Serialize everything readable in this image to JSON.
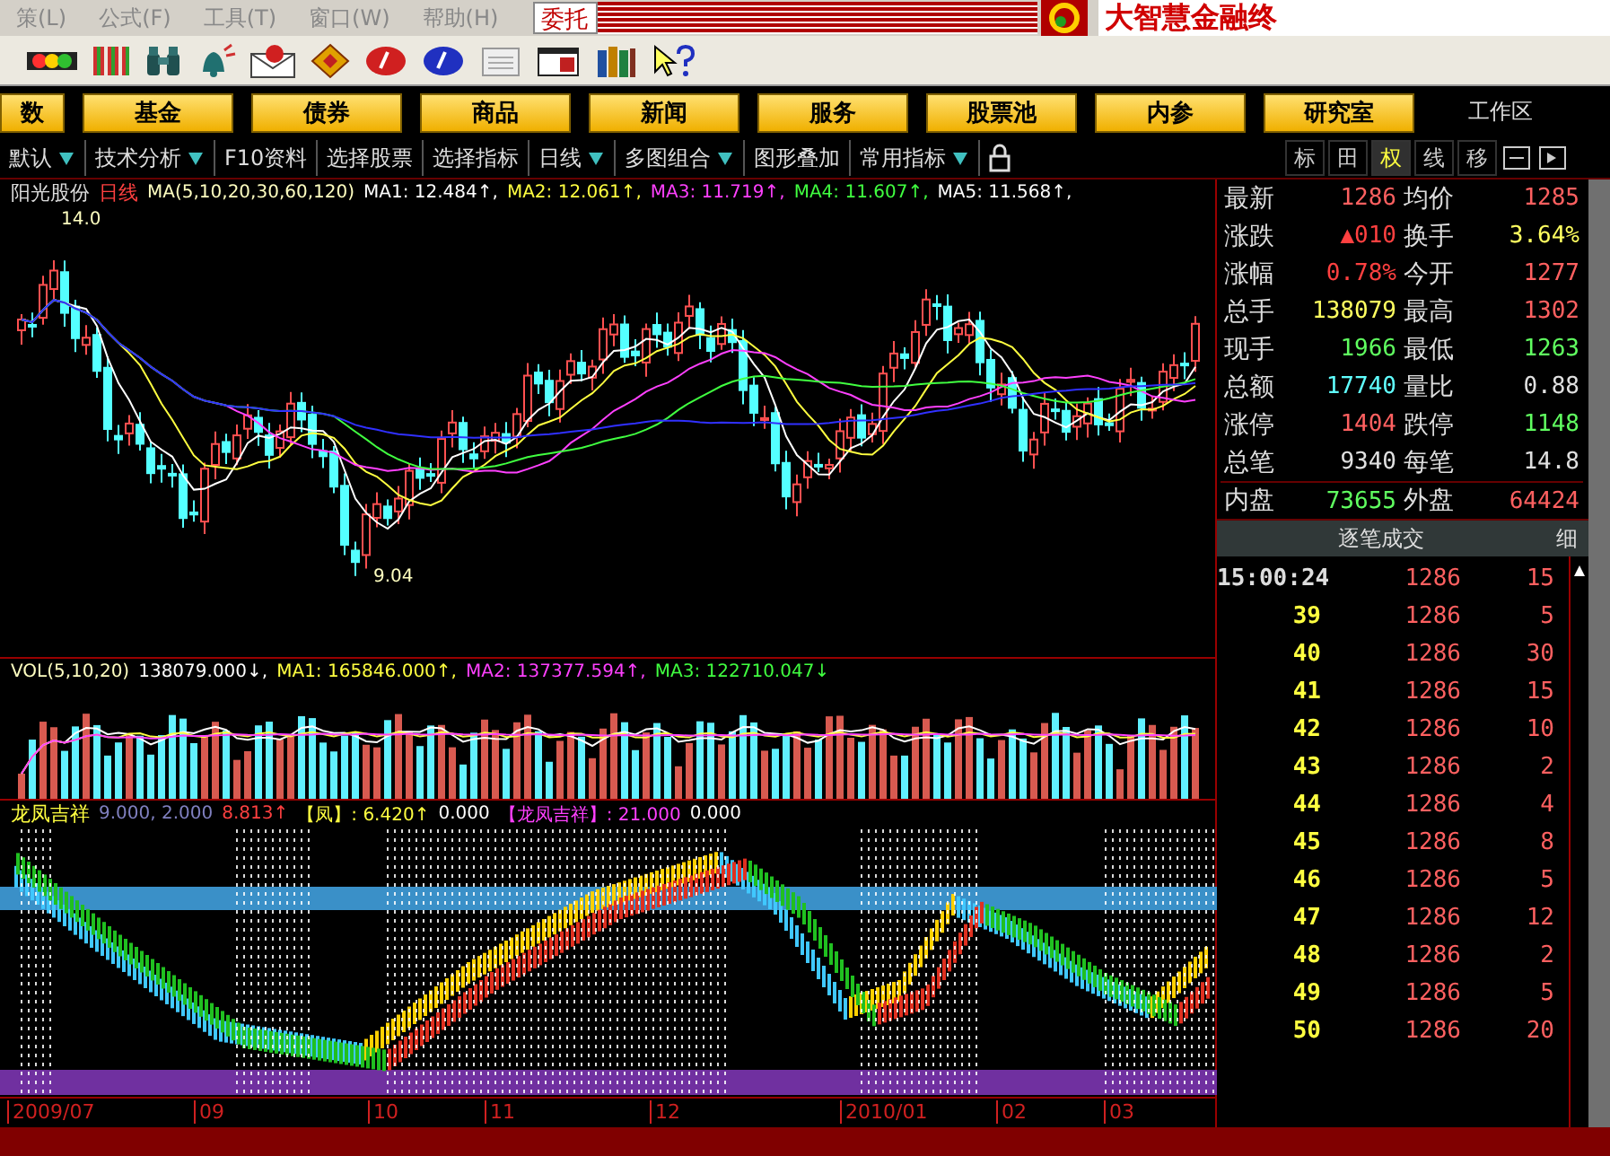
{
  "menu_bar": {
    "items": [
      "策(L)",
      "公式(F)",
      "工具(T)",
      "窗口(W)",
      "帮助(H)"
    ],
    "order_button": "委托",
    "brand": "大智慧金融终"
  },
  "market_buttons": [
    "数",
    "基金",
    "债券",
    "商品",
    "新闻",
    "服务",
    "股票池",
    "内参",
    "研究室"
  ],
  "workspace": "工作区",
  "view_tabs": [
    {
      "label": "默认",
      "dropdown": true
    },
    {
      "label": "技术分析",
      "dropdown": true
    },
    {
      "label": "F10资料",
      "dropdown": false
    },
    {
      "label": "选择股票",
      "dropdown": false
    },
    {
      "label": "选择指标",
      "dropdown": false
    },
    {
      "label": "日线",
      "dropdown": true
    },
    {
      "label": "多图组合",
      "dropdown": true
    },
    {
      "label": "图形叠加",
      "dropdown": false
    },
    {
      "label": "常用指标",
      "dropdown": true
    }
  ],
  "panel_tabs": [
    {
      "label": "标",
      "selected": false
    },
    {
      "label": "田",
      "selected": false
    },
    {
      "label": "权",
      "selected": true
    },
    {
      "label": "线",
      "selected": false
    },
    {
      "label": "移",
      "selected": false
    }
  ],
  "price_chart": {
    "stock": "阳光股份",
    "period": "日线",
    "params": "MA(5,10,20,30,60,120)",
    "values": [
      {
        "text": "MA1: 12.484↑,",
        "color": "#ffffff"
      },
      {
        "text": "MA2: 12.061↑,",
        "color": "#ffff40"
      },
      {
        "text": "MA3: 11.719↑,",
        "color": "#ff40ff"
      },
      {
        "text": "MA4: 11.607↑,",
        "color": "#40ff40"
      },
      {
        "text": "MA5: 11.568↑,",
        "color": "#ffffff"
      }
    ],
    "high_label": "14.0",
    "low_label": "9.04"
  },
  "volume_chart": {
    "title": "VOL(5,10,20)",
    "values": [
      {
        "text": "138079.000↓,",
        "color": "#ffffff"
      },
      {
        "text": "MA1: 165846.000↑,",
        "color": "#ffff40"
      },
      {
        "text": "MA2: 137377.594↑,",
        "color": "#ff40ff"
      },
      {
        "text": "MA3: 122710.047↓",
        "color": "#40ff40"
      }
    ]
  },
  "indicator": {
    "name": "龙凤吉祥",
    "values": [
      {
        "text": "9.000, 2.000",
        "color": "#8080c0"
      },
      {
        "text": "8.813↑",
        "color": "#ff4040"
      },
      {
        "text": "【凤】: 6.420↑",
        "color": "#ffff40"
      },
      {
        "text": "0.000",
        "color": "#ffffff"
      },
      {
        "text": "【龙凤吉祥】: 21.000",
        "color": "#ff40ff"
      },
      {
        "text": "0.000",
        "color": "#ffffff"
      }
    ]
  },
  "date_axis": [
    "2009/07",
    "09",
    "10",
    "11",
    "12",
    "2010/01",
    "02",
    "03"
  ],
  "quote": [
    {
      "label": "最新",
      "value": "1286",
      "color": "#ff6060"
    },
    {
      "label": "均价",
      "value": "1285",
      "color": "#ff6060"
    },
    {
      "label": "涨跌",
      "value": "▲010",
      "color": "#ff4040"
    },
    {
      "label": "换手",
      "value": "3.64%",
      "color": "#ffff60"
    },
    {
      "label": "涨幅",
      "value": "0.78%",
      "color": "#ff4040"
    },
    {
      "label": "今开",
      "value": "1277",
      "color": "#ff6060"
    },
    {
      "label": "总手",
      "value": "138079",
      "color": "#ffff60"
    },
    {
      "label": "最高",
      "value": "1302",
      "color": "#ff6060"
    },
    {
      "label": "现手",
      "value": "1966",
      "color": "#60ff60"
    },
    {
      "label": "最低",
      "value": "1263",
      "color": "#60ff60"
    },
    {
      "label": "总额",
      "value": "17740",
      "color": "#60ffff"
    },
    {
      "label": "量比",
      "value": "0.88",
      "color": "#e0e0e0"
    },
    {
      "label": "涨停",
      "value": "1404",
      "color": "#ff6060"
    },
    {
      "label": "跌停",
      "value": "1148",
      "color": "#60ff60"
    },
    {
      "label": "总笔",
      "value": "9340",
      "color": "#e0e0e0"
    },
    {
      "label": "每笔",
      "value": "14.8",
      "color": "#e0e0e0"
    },
    {
      "label": "内盘",
      "value": "73655",
      "color": "#60ff60"
    },
    {
      "label": "外盘",
      "value": "64424",
      "color": "#ff6060"
    }
  ],
  "trades": {
    "title": "逐笔成交",
    "detail_button": "细",
    "rows": [
      {
        "time": "15:00:24",
        "price": "1286",
        "volume": "15"
      },
      {
        "time": "39",
        "price": "1286",
        "volume": "5"
      },
      {
        "time": "40",
        "price": "1286",
        "volume": "30"
      },
      {
        "time": "41",
        "price": "1286",
        "volume": "15"
      },
      {
        "time": "42",
        "price": "1286",
        "volume": "10"
      },
      {
        "time": "43",
        "price": "1286",
        "volume": "2"
      },
      {
        "time": "44",
        "price": "1286",
        "volume": "4"
      },
      {
        "time": "45",
        "price": "1286",
        "volume": "8"
      },
      {
        "time": "46",
        "price": "1286",
        "volume": "5"
      },
      {
        "time": "47",
        "price": "1286",
        "volume": "12"
      },
      {
        "time": "48",
        "price": "1286",
        "volume": "2"
      },
      {
        "time": "49",
        "price": "1286",
        "volume": "5"
      },
      {
        "time": "50",
        "price": "1286",
        "volume": "20"
      }
    ]
  }
}
